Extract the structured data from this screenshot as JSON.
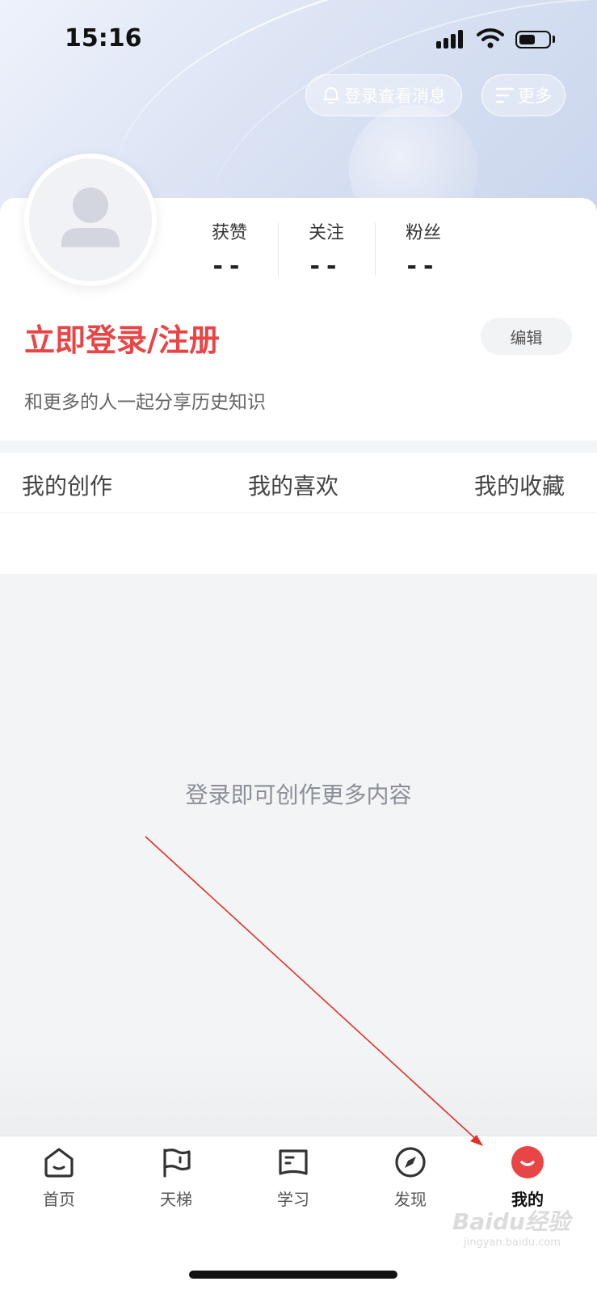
{
  "status_bar": {
    "time": "15:16",
    "battery_level": 0.55
  },
  "header": {
    "messages_label": "登录查看消息",
    "more_label": "更多"
  },
  "profile": {
    "stats": [
      {
        "label": "获赞",
        "value": "--"
      },
      {
        "label": "关注",
        "value": "--"
      },
      {
        "label": "粉丝",
        "value": "--"
      }
    ],
    "login_title": "立即登录/注册",
    "edit_label": "编辑",
    "subtitle": "和更多的人一起分享历史知识"
  },
  "tabs": [
    "我的创作",
    "我的喜欢",
    "我的收藏"
  ],
  "empty_state": "登录即可创作更多内容",
  "tabbar": {
    "items": [
      {
        "label": "首页",
        "icon": "home-icon"
      },
      {
        "label": "天梯",
        "icon": "flag-icon"
      },
      {
        "label": "学习",
        "icon": "book-icon"
      },
      {
        "label": "发现",
        "icon": "compass-icon"
      },
      {
        "label": "我的",
        "icon": "profile-icon",
        "active": true
      }
    ]
  },
  "watermark": {
    "brand": "Baidu经验",
    "url": "jingyan.baidu.com"
  },
  "colors": {
    "accent": "#e84646",
    "annotation_arrow": "#e0322a"
  }
}
